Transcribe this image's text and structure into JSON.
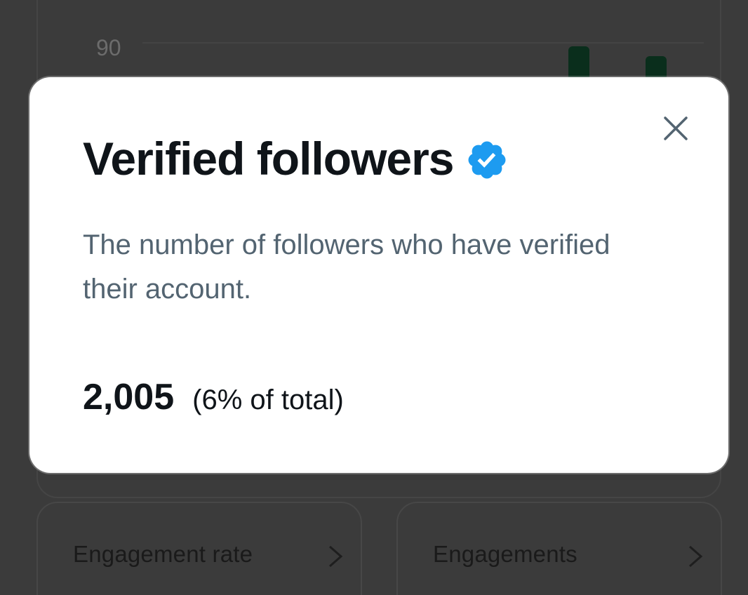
{
  "background": {
    "chart": {
      "y_tick_label": "90"
    },
    "tiles": [
      {
        "label": "Engagement rate"
      },
      {
        "label": "Engagements"
      }
    ]
  },
  "modal": {
    "title": "Verified followers",
    "badge_icon": "verified-badge-icon",
    "badge_color": "#1d9bf0",
    "description": "The number of followers who have verified their account.",
    "stat_value": "2,005",
    "stat_share": "(6% of total)",
    "close_icon": "close-icon"
  }
}
